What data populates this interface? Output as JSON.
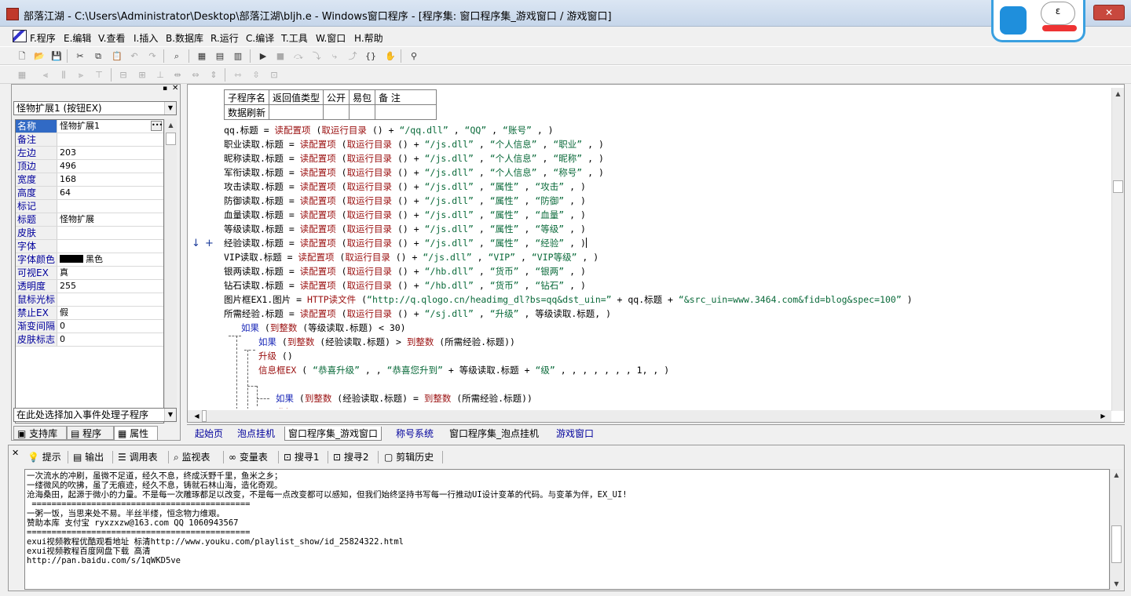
{
  "window": {
    "title": "部落江湖 - C:\\Users\\Administrator\\Desktop\\部落江湖\\bljh.e - Windows窗口程序 - [程序集: 窗口程序集_游戏窗口 / 游戏窗口]",
    "mascot_text": "ε"
  },
  "menu": [
    {
      "label": "F.程序"
    },
    {
      "label": "E.编辑"
    },
    {
      "label": "V.查看"
    },
    {
      "label": "I.插入"
    },
    {
      "label": "B.数据库"
    },
    {
      "label": "R.运行"
    },
    {
      "label": "C.编译"
    },
    {
      "label": "T.工具"
    },
    {
      "label": "W.窗口"
    },
    {
      "label": "H.帮助"
    }
  ],
  "left_panel": {
    "component_select": "怪物扩展1 (按钮EX)",
    "properties": [
      {
        "name": "名称",
        "value": "怪物扩展1"
      },
      {
        "name": "备注",
        "value": ""
      },
      {
        "name": "左边",
        "value": "203"
      },
      {
        "name": "顶边",
        "value": "496"
      },
      {
        "name": "宽度",
        "value": "168"
      },
      {
        "name": "高度",
        "value": "64"
      },
      {
        "name": "标记",
        "value": ""
      },
      {
        "name": "标题",
        "value": "怪物扩展"
      },
      {
        "name": "皮肤",
        "value": ""
      },
      {
        "name": "字体",
        "value": ""
      },
      {
        "name": "字体颜色",
        "value": "黑色"
      },
      {
        "name": "可视EX",
        "value": "真"
      },
      {
        "name": "透明度",
        "value": "255"
      },
      {
        "name": "鼠标光标",
        "value": ""
      },
      {
        "name": "禁止EX",
        "value": "假"
      },
      {
        "name": "渐变间隔",
        "value": "0"
      },
      {
        "name": "皮肤标志",
        "value": "0"
      }
    ],
    "event_select": "在此处选择加入事件处理子程序",
    "tabs": [
      {
        "label": "支持库"
      },
      {
        "label": "程序"
      },
      {
        "label": "属性"
      }
    ]
  },
  "editor": {
    "sub_table": {
      "headers": [
        "子程序名",
        "返回值类型",
        "公开",
        "易包",
        "备 注"
      ],
      "row": [
        "数据刷新",
        "",
        "",
        "",
        ""
      ]
    },
    "lines": [
      [
        [
          "",
          "qq.标题 = "
        ],
        [
          "fn",
          "读配置项"
        ],
        [
          "",
          " ("
        ],
        [
          "fn",
          "取运行目录"
        ],
        [
          "",
          " () + "
        ],
        [
          "str",
          "“/qq.dll”"
        ],
        [
          "",
          " , "
        ],
        [
          "str",
          "“QQ”"
        ],
        [
          "",
          " , "
        ],
        [
          "str",
          "“账号”"
        ],
        [
          "",
          " , )"
        ]
      ],
      [
        [
          "",
          "职业读取.标题 = "
        ],
        [
          "fn",
          "读配置项"
        ],
        [
          "",
          " ("
        ],
        [
          "fn",
          "取运行目录"
        ],
        [
          "",
          " () + "
        ],
        [
          "str",
          "“/js.dll”"
        ],
        [
          "",
          " , "
        ],
        [
          "str",
          "“个人信息”"
        ],
        [
          "",
          " , "
        ],
        [
          "str",
          "“职业”"
        ],
        [
          "",
          " , )"
        ]
      ],
      [
        [
          "",
          "昵称读取.标题 = "
        ],
        [
          "fn",
          "读配置项"
        ],
        [
          "",
          " ("
        ],
        [
          "fn",
          "取运行目录"
        ],
        [
          "",
          " () + "
        ],
        [
          "str",
          "“/js.dll”"
        ],
        [
          "",
          " , "
        ],
        [
          "str",
          "“个人信息”"
        ],
        [
          "",
          " , "
        ],
        [
          "str",
          "“昵称”"
        ],
        [
          "",
          " , )"
        ]
      ],
      [
        [
          "",
          "军衔读取.标题 = "
        ],
        [
          "fn",
          "读配置项"
        ],
        [
          "",
          " ("
        ],
        [
          "fn",
          "取运行目录"
        ],
        [
          "",
          " () + "
        ],
        [
          "str",
          "“/js.dll”"
        ],
        [
          "",
          " , "
        ],
        [
          "str",
          "“个人信息”"
        ],
        [
          "",
          " , "
        ],
        [
          "str",
          "“称号”"
        ],
        [
          "",
          " , )"
        ]
      ],
      [
        [
          "",
          "攻击读取.标题 = "
        ],
        [
          "fn",
          "读配置项"
        ],
        [
          "",
          " ("
        ],
        [
          "fn",
          "取运行目录"
        ],
        [
          "",
          " () + "
        ],
        [
          "str",
          "“/js.dll”"
        ],
        [
          "",
          " , "
        ],
        [
          "str",
          "“属性”"
        ],
        [
          "",
          " , "
        ],
        [
          "str",
          "“攻击”"
        ],
        [
          "",
          " , )"
        ]
      ],
      [
        [
          "",
          "防御读取.标题 = "
        ],
        [
          "fn",
          "读配置项"
        ],
        [
          "",
          " ("
        ],
        [
          "fn",
          "取运行目录"
        ],
        [
          "",
          " () + "
        ],
        [
          "str",
          "“/js.dll”"
        ],
        [
          "",
          " , "
        ],
        [
          "str",
          "“属性”"
        ],
        [
          "",
          " , "
        ],
        [
          "str",
          "“防御”"
        ],
        [
          "",
          " , )"
        ]
      ],
      [
        [
          "",
          "血量读取.标题 = "
        ],
        [
          "fn",
          "读配置项"
        ],
        [
          "",
          " ("
        ],
        [
          "fn",
          "取运行目录"
        ],
        [
          "",
          " () + "
        ],
        [
          "str",
          "“/js.dll”"
        ],
        [
          "",
          " , "
        ],
        [
          "str",
          "“属性”"
        ],
        [
          "",
          " , "
        ],
        [
          "str",
          "“血量”"
        ],
        [
          "",
          " , )"
        ]
      ],
      [
        [
          "",
          "等级读取.标题 = "
        ],
        [
          "fn",
          "读配置项"
        ],
        [
          "",
          " ("
        ],
        [
          "fn",
          "取运行目录"
        ],
        [
          "",
          " () + "
        ],
        [
          "str",
          "“/js.dll”"
        ],
        [
          "",
          " , "
        ],
        [
          "str",
          "“属性”"
        ],
        [
          "",
          " , "
        ],
        [
          "str",
          "“等级”"
        ],
        [
          "",
          " , )"
        ]
      ],
      [
        [
          "",
          "经验读取.标题 = "
        ],
        [
          "fn",
          "读配置项"
        ],
        [
          "",
          " ("
        ],
        [
          "fn",
          "取运行目录"
        ],
        [
          "",
          " () + "
        ],
        [
          "str",
          "“/js.dll”"
        ],
        [
          "",
          " , "
        ],
        [
          "str",
          "“属性”"
        ],
        [
          "",
          " , "
        ],
        [
          "str",
          "“经验”"
        ],
        [
          "",
          " , )"
        ]
      ],
      [
        [
          "",
          "VIP读取.标题 = "
        ],
        [
          "fn",
          "读配置项"
        ],
        [
          "",
          " ("
        ],
        [
          "fn",
          "取运行目录"
        ],
        [
          "",
          " () + "
        ],
        [
          "str",
          "“/js.dll”"
        ],
        [
          "",
          " , "
        ],
        [
          "str",
          "“VIP”"
        ],
        [
          "",
          " , "
        ],
        [
          "str",
          "“VIP等级”"
        ],
        [
          "",
          " , )"
        ]
      ],
      [
        [
          "",
          "银两读取.标题 = "
        ],
        [
          "fn",
          "读配置项"
        ],
        [
          "",
          " ("
        ],
        [
          "fn",
          "取运行目录"
        ],
        [
          "",
          " () + "
        ],
        [
          "str",
          "“/hb.dll”"
        ],
        [
          "",
          " , "
        ],
        [
          "str",
          "“货币”"
        ],
        [
          "",
          " , "
        ],
        [
          "str",
          "“银两”"
        ],
        [
          "",
          " , )"
        ]
      ],
      [
        [
          "",
          "钻石读取.标题 = "
        ],
        [
          "fn",
          "读配置项"
        ],
        [
          "",
          " ("
        ],
        [
          "fn",
          "取运行目录"
        ],
        [
          "",
          " () + "
        ],
        [
          "str",
          "“/hb.dll”"
        ],
        [
          "",
          " , "
        ],
        [
          "str",
          "“货币”"
        ],
        [
          "",
          " , "
        ],
        [
          "str",
          "“钻石”"
        ],
        [
          "",
          " , )"
        ]
      ],
      [
        [
          "",
          "图片框EX1.图片 = "
        ],
        [
          "fn",
          "HTTP读文件"
        ],
        [
          "",
          " ("
        ],
        [
          "str",
          "“http://q.qlogo.cn/headimg_dl?bs=qq&dst_uin=”"
        ],
        [
          "",
          " + qq.标题 + "
        ],
        [
          "str",
          "“&src_uin=www.3464.com&fid=blog&spec=100”"
        ],
        [
          "",
          " )"
        ]
      ],
      [
        [
          "",
          "所需经验.标题 = "
        ],
        [
          "fn",
          "读配置项"
        ],
        [
          "",
          " ("
        ],
        [
          "fn",
          "取运行目录"
        ],
        [
          "",
          " () + "
        ],
        [
          "str",
          "“/sj.dll”"
        ],
        [
          "",
          " , "
        ],
        [
          "str",
          "“升级”"
        ],
        [
          "",
          " , 等级读取.标题, )"
        ]
      ],
      [
        [
          "blue",
          "如果"
        ],
        [
          "",
          " ("
        ],
        [
          "fn",
          "到整数"
        ],
        [
          "",
          " (等级读取.标题) < 30)"
        ]
      ],
      [
        [
          "blue",
          "如果"
        ],
        [
          "",
          " ("
        ],
        [
          "fn",
          "到整数"
        ],
        [
          "",
          " (经验读取.标题) > "
        ],
        [
          "fn",
          "到整数"
        ],
        [
          "",
          " (所需经验.标题))"
        ]
      ],
      [
        [
          "fn",
          "升级"
        ],
        [
          "",
          " ()"
        ]
      ],
      [
        [
          "fn",
          "信息框EX"
        ],
        [
          "",
          " ( "
        ],
        [
          "str",
          "“恭喜升级”"
        ],
        [
          "",
          " , , "
        ],
        [
          "str",
          "“恭喜您升到”"
        ],
        [
          "",
          " + 等级读取.标题 + "
        ],
        [
          "str",
          "“级”"
        ],
        [
          "",
          " , , , , , , , 1, , )"
        ]
      ],
      [
        [
          "",
          ""
        ]
      ],
      [
        [
          "blue",
          "如果"
        ],
        [
          "",
          " ("
        ],
        [
          "fn",
          "到整数"
        ],
        [
          "",
          " (经验读取.标题) = "
        ],
        [
          "fn",
          "到整数"
        ],
        [
          "",
          " (所需经验.标题))"
        ]
      ],
      [
        [
          "fn",
          "升级"
        ],
        [
          "",
          " ()"
        ]
      ]
    ]
  },
  "file_tabs": [
    {
      "label": "起始页"
    },
    {
      "label": "泡点挂机"
    },
    {
      "label": "窗口程序集_游戏窗口"
    },
    {
      "label": "称号系统"
    },
    {
      "label": "窗口程序集_泡点挂机"
    },
    {
      "label": "游戏窗口"
    }
  ],
  "bottom_tabs": [
    {
      "label": "提示",
      "icon": "lightbulb-icon"
    },
    {
      "label": "输出",
      "icon": "output-icon"
    },
    {
      "label": "调用表",
      "icon": "call-table-icon"
    },
    {
      "label": "监视表",
      "icon": "magnifier-icon"
    },
    {
      "label": "变量表",
      "icon": "glasses-icon"
    },
    {
      "label": "搜寻1",
      "icon": "search-1-icon"
    },
    {
      "label": "搜寻2",
      "icon": "search-2-icon"
    },
    {
      "label": "剪辑历史",
      "icon": "clip-history-icon"
    }
  ],
  "output_text": "一次流水的冲刷，虽微不足道，经久不息，终成沃野千里，鱼米之乡；\n一缕微风的吹拂，虽了无痕迹，经久不息，铸就石林山海，造化奇观。\n沧海桑田，起源于微小的力量。不是每一次雕琢都足以改变，不是每一点改变都可以感知，但我们始终坚持书写每一行推动UI设计变革的代码。与变革为伴，EX_UI!\n ============================================\n一粥一饭，当思来处不易。半丝半缕，恒念物力维艰。\n赞助本库 支付宝 ryxzxzw@163.com QQ 1060943567\n=============================================\nexui视频教程优酷观看地址 标清http://www.youku.com/playlist_show/id_25824322.html\nexui视频教程百度网盘下载 高清\nhttp://pan.baidu.com/s/1qWKD5ve",
  "colors": {
    "function": "#9a0f0f",
    "string": "#0a6a3a",
    "keyword": "#1c2ab8",
    "selection": "#316ac5"
  }
}
